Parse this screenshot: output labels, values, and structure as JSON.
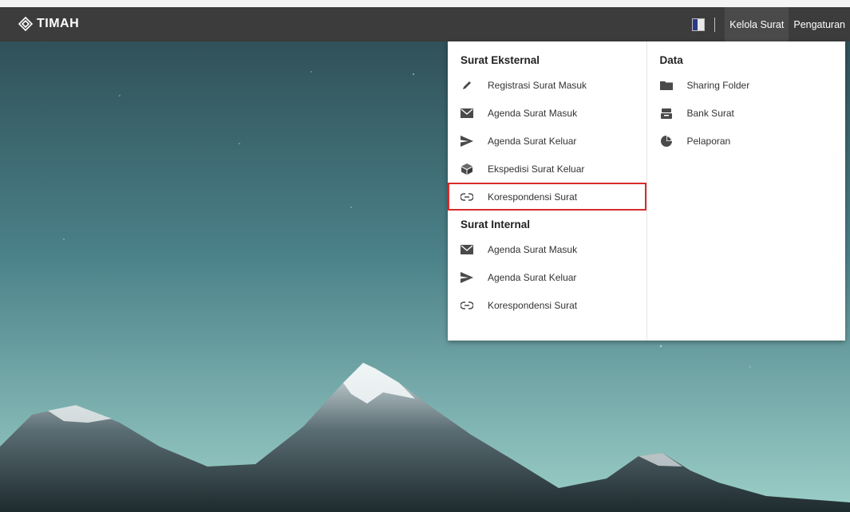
{
  "header": {
    "logo_text": "TIMAH",
    "nav": [
      {
        "label": "Kelola Surat",
        "active": true
      },
      {
        "label": "Pengaturan",
        "active": false
      }
    ]
  },
  "menu": {
    "left": {
      "sections": [
        {
          "title": "Surat Eksternal",
          "items": [
            {
              "label": "Registrasi Surat Masuk",
              "icon": "pencil-icon"
            },
            {
              "label": "Agenda Surat Masuk",
              "icon": "envelope-icon"
            },
            {
              "label": "Agenda Surat Keluar",
              "icon": "send-icon"
            },
            {
              "label": "Ekspedisi Surat Keluar",
              "icon": "cube-icon"
            },
            {
              "label": "Korespondensi Surat",
              "icon": "link-icon",
              "highlighted": true
            }
          ]
        },
        {
          "title": "Surat Internal",
          "items": [
            {
              "label": "Agenda Surat Masuk",
              "icon": "envelope-icon"
            },
            {
              "label": "Agenda Surat Keluar",
              "icon": "send-icon"
            },
            {
              "label": "Korespondensi Surat",
              "icon": "link-icon"
            }
          ]
        }
      ]
    },
    "right": {
      "title": "Data",
      "items": [
        {
          "label": "Sharing Folder",
          "icon": "folder-icon"
        },
        {
          "label": "Bank Surat",
          "icon": "archive-icon"
        },
        {
          "label": "Pelaporan",
          "icon": "pie-chart-icon"
        }
      ]
    }
  },
  "colors": {
    "topbar": "#3c3c3c",
    "highlight_border": "#d92b2b"
  }
}
